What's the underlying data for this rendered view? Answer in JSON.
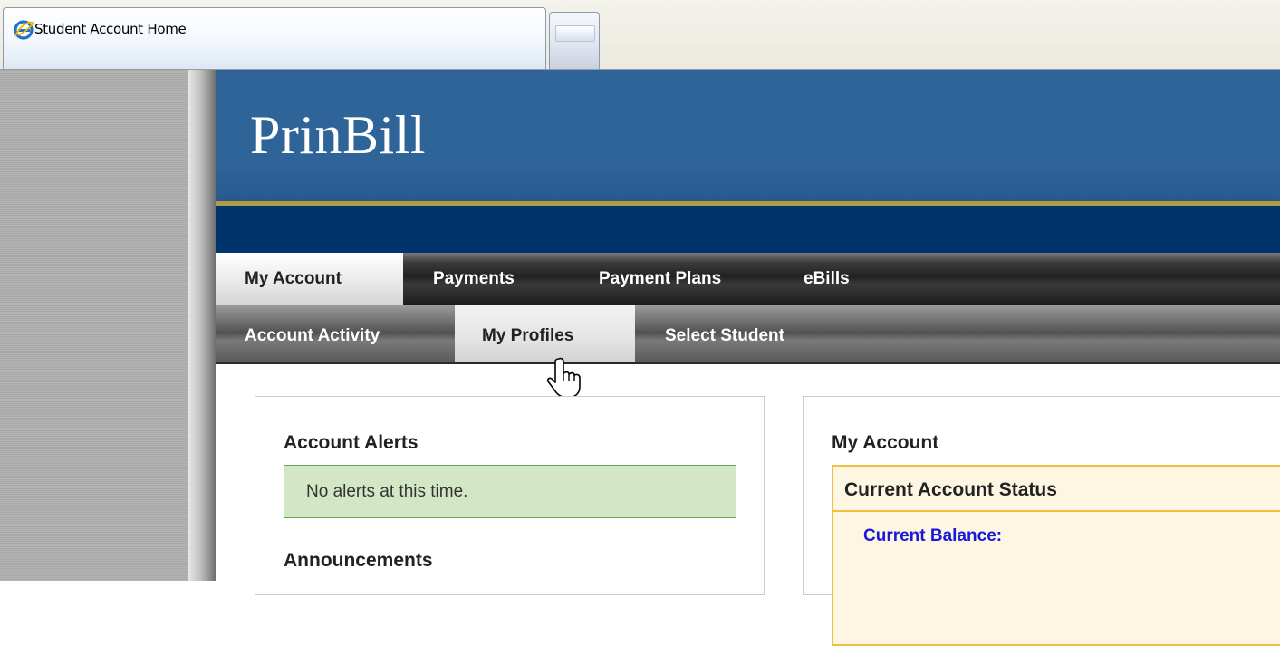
{
  "browser": {
    "tab_title": "Student Account Home",
    "icons": {
      "tab_icon": "ie-icon",
      "new_tab": "new-tab-icon"
    }
  },
  "header": {
    "logo": "PrinBill"
  },
  "nav_primary": {
    "items": [
      {
        "label": "My Account",
        "active": true
      },
      {
        "label": "Payments",
        "active": false
      },
      {
        "label": "Payment Plans",
        "active": false
      },
      {
        "label": "eBills",
        "active": false
      }
    ]
  },
  "nav_secondary": {
    "items": [
      {
        "label": "Account Activity",
        "active": false
      },
      {
        "label": "My Profiles",
        "active": true
      },
      {
        "label": "Select Student",
        "active": false
      }
    ]
  },
  "left_panel": {
    "alerts_title": "Account Alerts",
    "alerts_message": "No alerts at this time.",
    "announcements_title": "Announcements"
  },
  "right_panel": {
    "title": "My Account",
    "status_title": "Current Account Status",
    "balance_label": "Current Balance:"
  },
  "colors": {
    "header_blue": "#2f6499",
    "navy_band": "#00346a",
    "gold_line": "#b39a46",
    "alert_bg": "#d3e7c6",
    "status_border": "#f2c040",
    "link_blue": "#1a1ad6"
  }
}
